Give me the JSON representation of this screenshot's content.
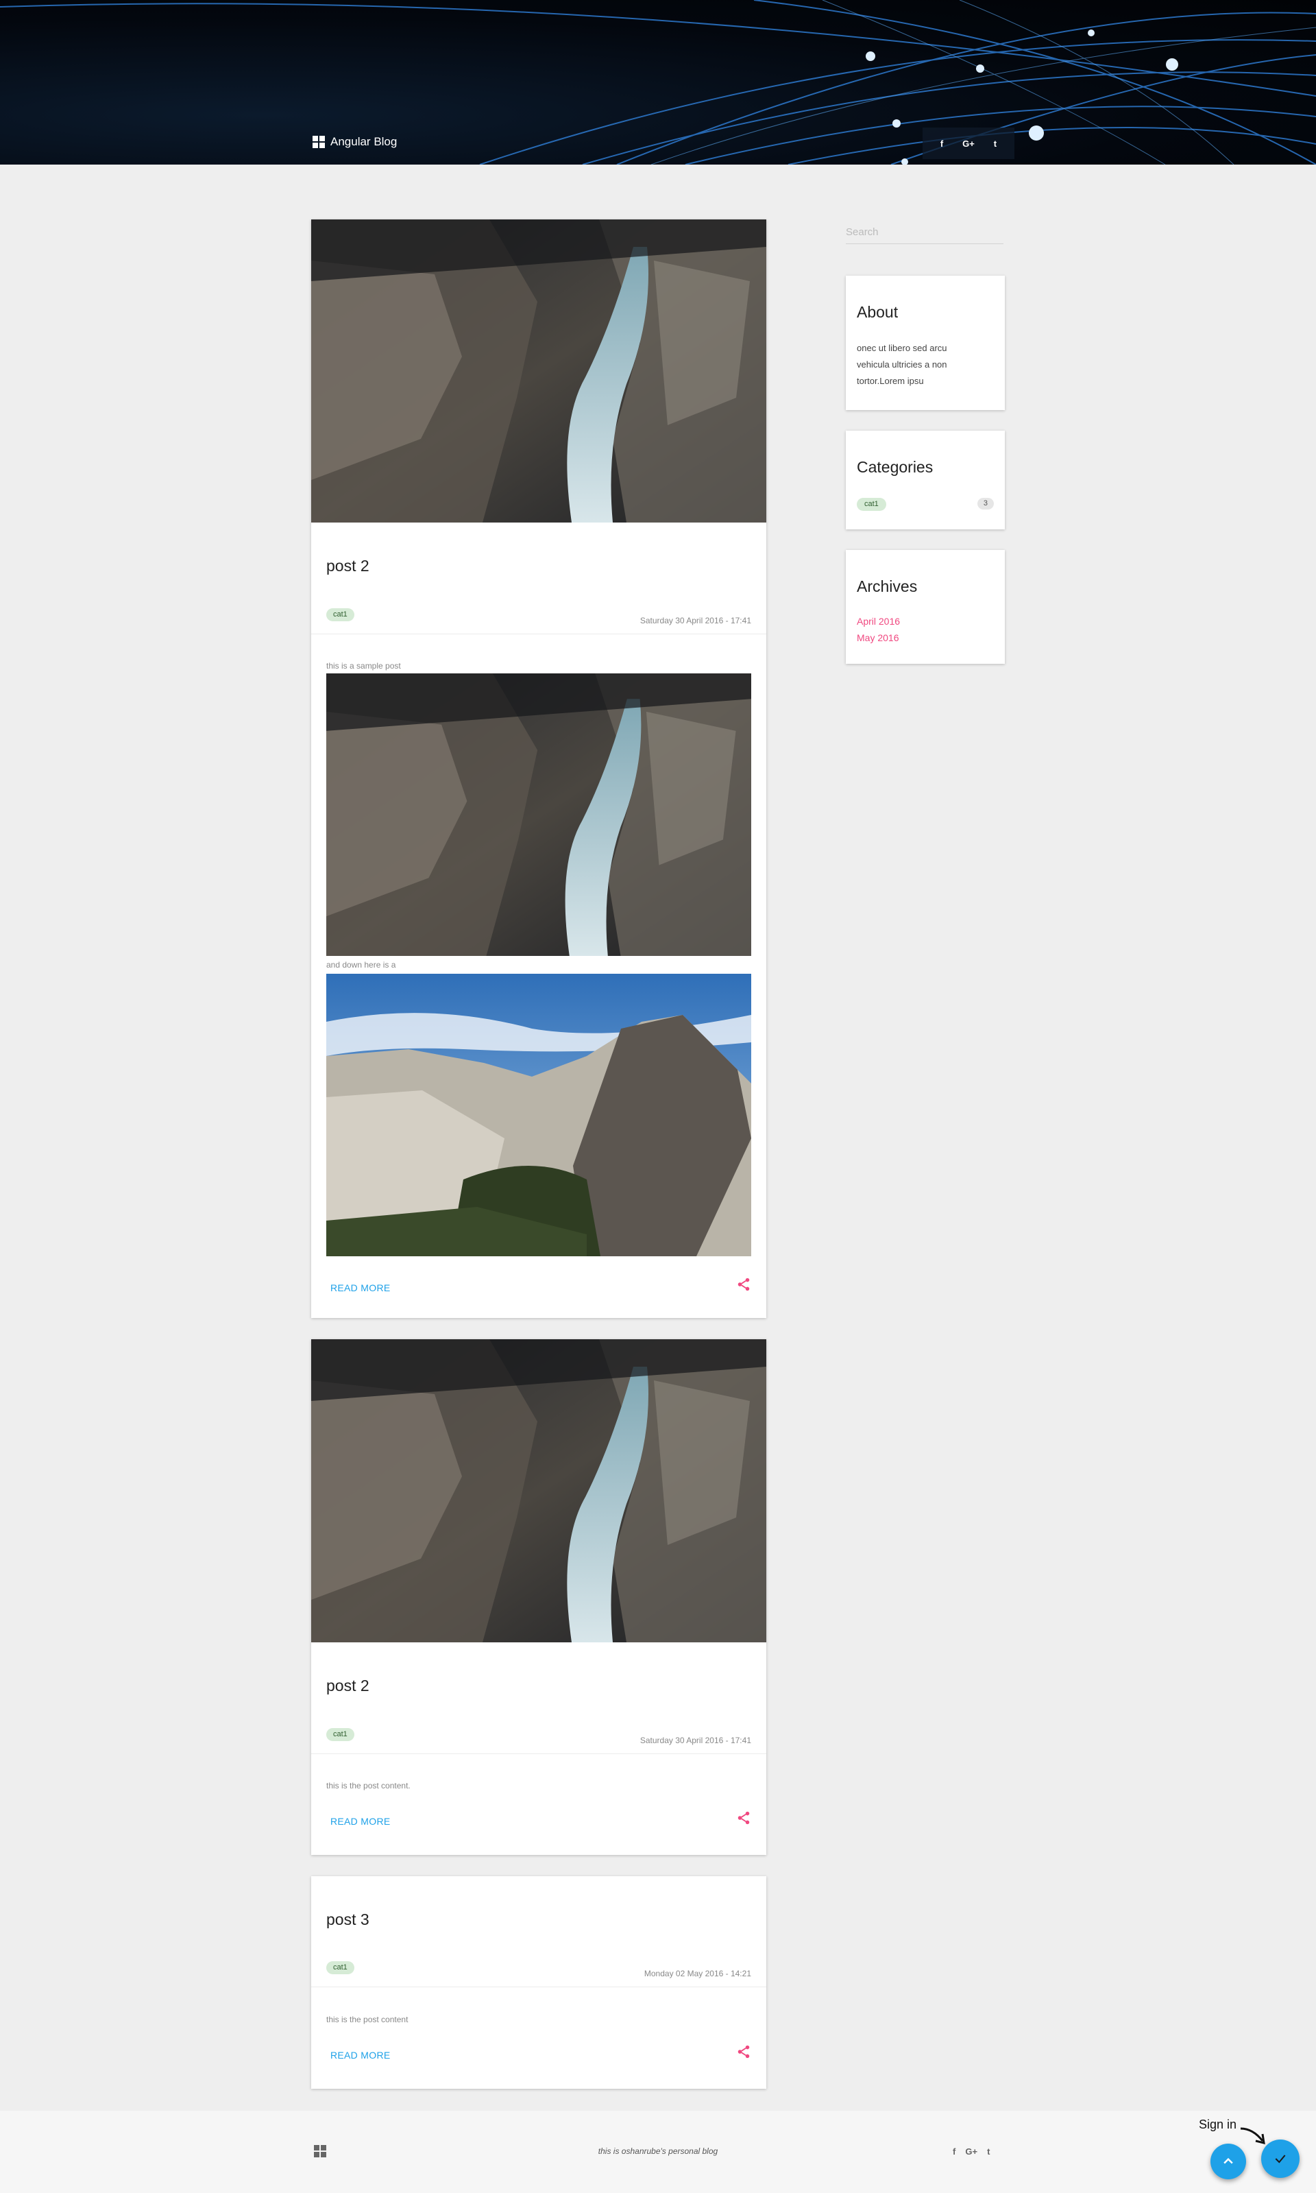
{
  "header": {
    "brand": "Angular Blog",
    "social": [
      "f",
      "G+",
      "t"
    ]
  },
  "posts": [
    {
      "title": "post 2",
      "category": "cat1",
      "date": "Saturday 30 April 2016 - 17:41",
      "content_line_1": "this is a sample post",
      "content_line_2": "and down here is a",
      "read_more": "READ MORE"
    },
    {
      "title": "post 2",
      "category": "cat1",
      "date": "Saturday 30 April 2016 - 17:41",
      "content": "this is the post content.",
      "read_more": "READ MORE"
    },
    {
      "title": "post 3",
      "category": "cat1",
      "date": "Monday 02 May 2016 - 14:21",
      "content": "this is the post content",
      "read_more": "READ MORE"
    }
  ],
  "sidebar": {
    "search_placeholder": "Search",
    "about": {
      "title": "About",
      "text": "onec ut libero sed arcu vehicula ultricies a non tortor.Lorem ipsu"
    },
    "categories": {
      "title": "Categories",
      "items": [
        {
          "name": "cat1",
          "count": "3"
        }
      ]
    },
    "archives": {
      "title": "Archives",
      "items": [
        "April 2016",
        "May 2016"
      ]
    }
  },
  "footer": {
    "text": "this is oshanrube's personal blog",
    "social": [
      "f",
      "G+",
      "t"
    ]
  },
  "fab": {
    "signin_label": "Sign in"
  },
  "colors": {
    "accent_blue": "#1ea1e8",
    "accent_pink": "#f04880",
    "chip_bg": "#d6ebd6"
  }
}
